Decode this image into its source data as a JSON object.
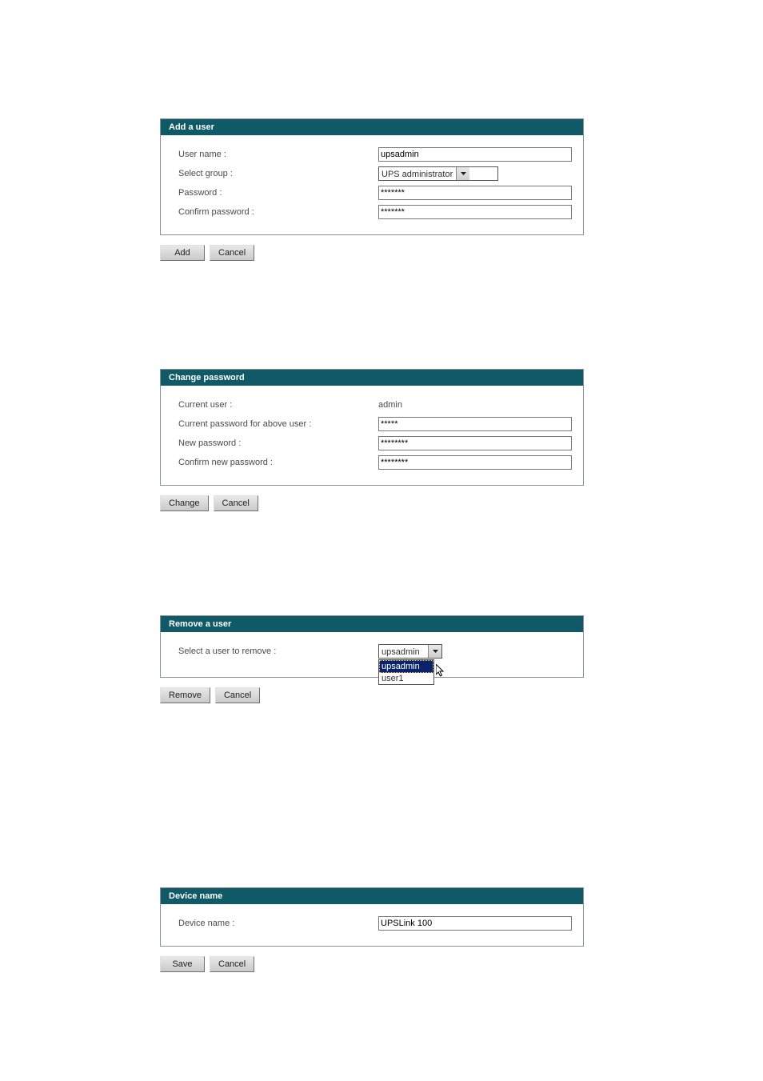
{
  "add_user": {
    "header": "Add a user",
    "labels": {
      "username": "User name :",
      "group": "Select group :",
      "password": "Password :",
      "confirm": "Confirm password :"
    },
    "values": {
      "username": "upsadmin",
      "group_selected": "UPS administrator",
      "password": "*******",
      "confirm": "*******"
    },
    "buttons": {
      "add": "Add",
      "cancel": "Cancel"
    }
  },
  "change_password": {
    "header": "Change password",
    "labels": {
      "current_user": "Current user :",
      "current_pw": "Current password for above user :",
      "new_pw": "New password :",
      "confirm_pw": "Confirm new password :"
    },
    "values": {
      "current_user": "admin",
      "current_pw": "*****",
      "new_pw": "********",
      "confirm_pw": "********"
    },
    "buttons": {
      "change": "Change",
      "cancel": "Cancel"
    }
  },
  "remove_user": {
    "header": "Remove a user",
    "labels": {
      "select": "Select a user to remove :"
    },
    "selected": "upsadmin",
    "options": [
      "upsadmin",
      "user1"
    ],
    "buttons": {
      "remove": "Remove",
      "cancel": "Cancel"
    }
  },
  "device_name": {
    "header": "Device name",
    "labels": {
      "name": "Device name :"
    },
    "value": "UPSLink 100",
    "buttons": {
      "save": "Save",
      "cancel": "Cancel"
    }
  }
}
